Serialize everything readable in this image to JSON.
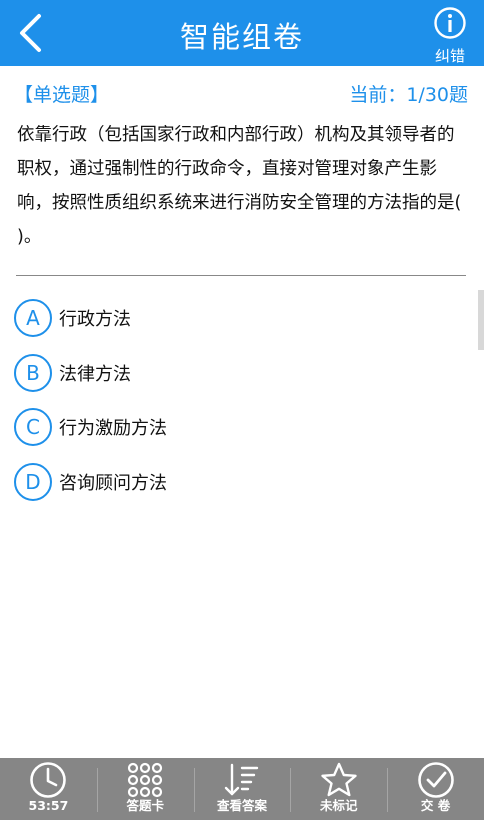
{
  "header": {
    "title": "智能组卷",
    "error_label": "纠错",
    "back_icon": "chevron-left-icon",
    "error_icon": "info-icon",
    "color": "#1e90ea"
  },
  "question": {
    "type": "【单选题】",
    "progress": "当前：1/30题",
    "text": "依靠行政（包括国家行政和内部行政）机构及其领导者的职权，通过强制性的行政命令，直接对管理对象产生影响，按照性质组织系统来进行消防安全管理的方法指的是(    )。"
  },
  "options": [
    {
      "letter": "A",
      "text": "行政方法"
    },
    {
      "letter": "B",
      "text": "法律方法"
    },
    {
      "letter": "C",
      "text": "行为激励方法"
    },
    {
      "letter": "D",
      "text": "咨询顾问方法"
    }
  ],
  "bottom_bar": {
    "timer": "53:57",
    "answer_card": "答题卡",
    "view_answer": "查看答案",
    "mark": "未标记",
    "submit": "交 卷",
    "background": "#868686"
  }
}
